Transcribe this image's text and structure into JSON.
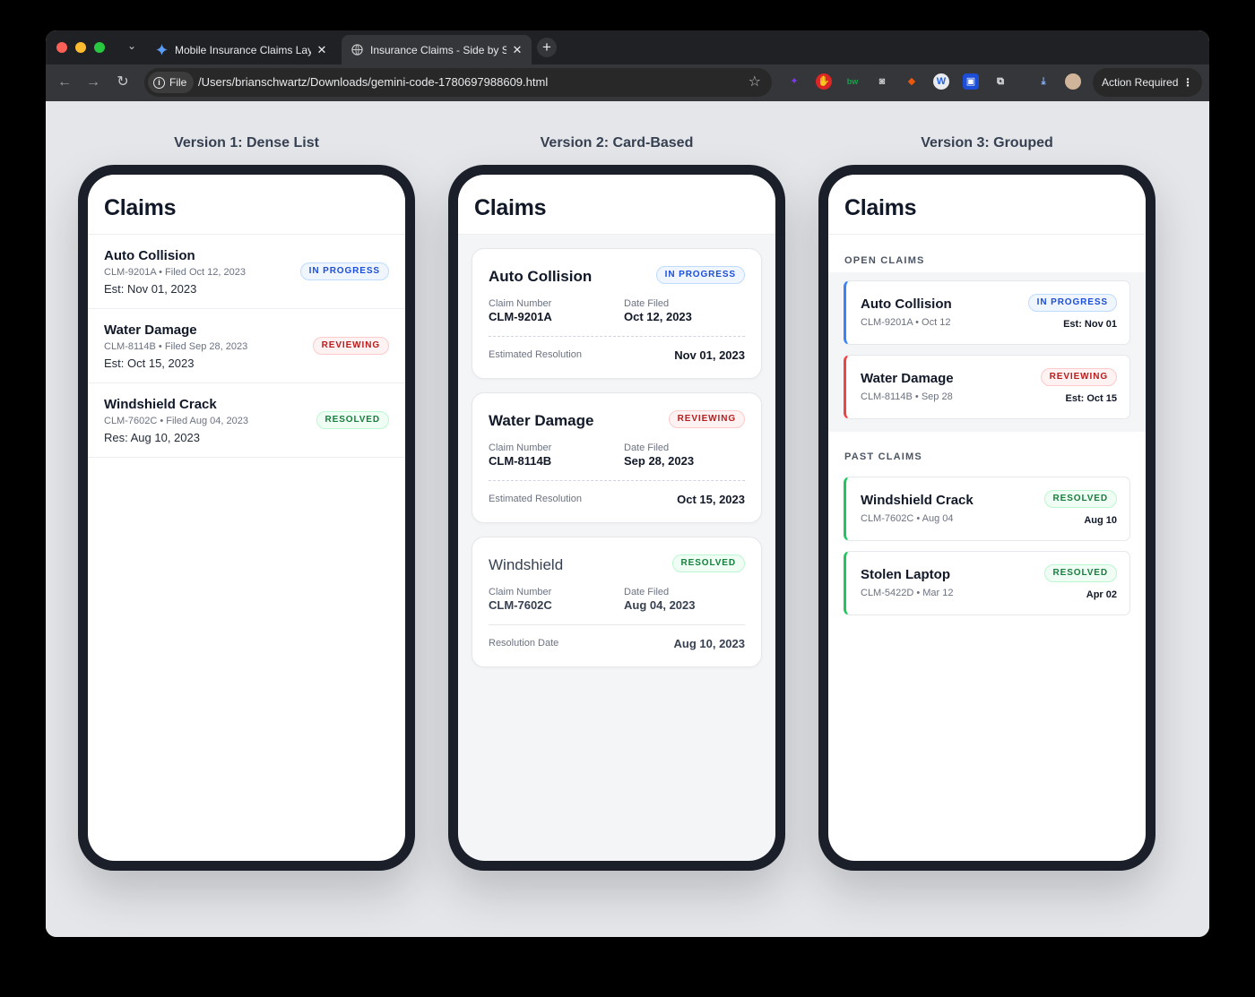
{
  "browser": {
    "tabs": [
      {
        "title": "Mobile Insurance Claims Layout",
        "active": false
      },
      {
        "title": "Insurance Claims - Side by Side",
        "active": true
      }
    ],
    "file_chip": "File",
    "url": "/Users/brianschwartz/Downloads/gemini-code-1780697988609.html",
    "action_chip": "Action Required",
    "new_tab_symbol": "+",
    "extension_icons": [
      "ai-sparkle-icon",
      "adblock-icon",
      "bw-icon",
      "camera-icon",
      "graduation-icon",
      "wordpress-icon",
      "screenshot-icon",
      "puzzle-icon",
      "download-icon",
      "avatar-icon"
    ]
  },
  "page": {
    "v1": {
      "title": "Version 1: Dense List",
      "header": "Claims",
      "rows": [
        {
          "title": "Auto Collision",
          "meta": "CLM-9201A • Filed Oct 12, 2023",
          "est": "Est: Nov 01, 2023",
          "status": "IN PROGRESS"
        },
        {
          "title": "Water Damage",
          "meta": "CLM-8114B • Filed Sep 28, 2023",
          "est": "Est: Oct 15, 2023",
          "status": "REVIEWING"
        },
        {
          "title": "Windshield Crack",
          "meta": "CLM-7602C • Filed Aug 04, 2023",
          "est": "Res: Aug 10, 2023",
          "status": "RESOLVED"
        }
      ]
    },
    "v2": {
      "title": "Version 2: Card-Based",
      "header": "Claims",
      "cards": [
        {
          "title": "Auto Collision",
          "status": "IN PROGRESS",
          "claim_label": "Claim Number",
          "claim": "CLM-9201A",
          "date_label": "Date Filed",
          "date": "Oct 12, 2023",
          "res_label": "Estimated Resolution",
          "res": "Nov 01, 2023"
        },
        {
          "title": "Water Damage",
          "status": "REVIEWING",
          "claim_label": "Claim Number",
          "claim": "CLM-8114B",
          "date_label": "Date Filed",
          "date": "Sep 28, 2023",
          "res_label": "Estimated Resolution",
          "res": "Oct 15, 2023"
        },
        {
          "title": "Windshield",
          "status": "RESOLVED",
          "claim_label": "Claim Number",
          "claim": "CLM-7602C",
          "date_label": "Date Filed",
          "date": "Aug 04, 2023",
          "res_label": "Resolution Date",
          "res": "Aug 10, 2023"
        }
      ]
    },
    "v3": {
      "title": "Version 3: Grouped",
      "header": "Claims",
      "open_label": "OPEN CLAIMS",
      "past_label": "PAST CLAIMS",
      "open": [
        {
          "title": "Auto Collision",
          "meta": "CLM-9201A • Oct 12",
          "status": "IN PROGRESS",
          "est": "Est: Nov 01"
        },
        {
          "title": "Water Damage",
          "meta": "CLM-8114B • Sep 28",
          "status": "REVIEWING",
          "est": "Est: Oct 15"
        }
      ],
      "past": [
        {
          "title": "Windshield Crack",
          "meta": "CLM-7602C • Aug 04",
          "status": "RESOLVED",
          "est": "Aug 10"
        },
        {
          "title": "Stolen Laptop",
          "meta": "CLM-5422D • Mar 12",
          "status": "RESOLVED",
          "est": "Apr 02"
        }
      ]
    }
  },
  "colors": {
    "in_progress": "#1d4ed8",
    "reviewing": "#b91c1c",
    "resolved": "#15803d",
    "accent_blue": "#3b82f6",
    "accent_red": "#ef4444",
    "accent_green": "#22c55e"
  }
}
